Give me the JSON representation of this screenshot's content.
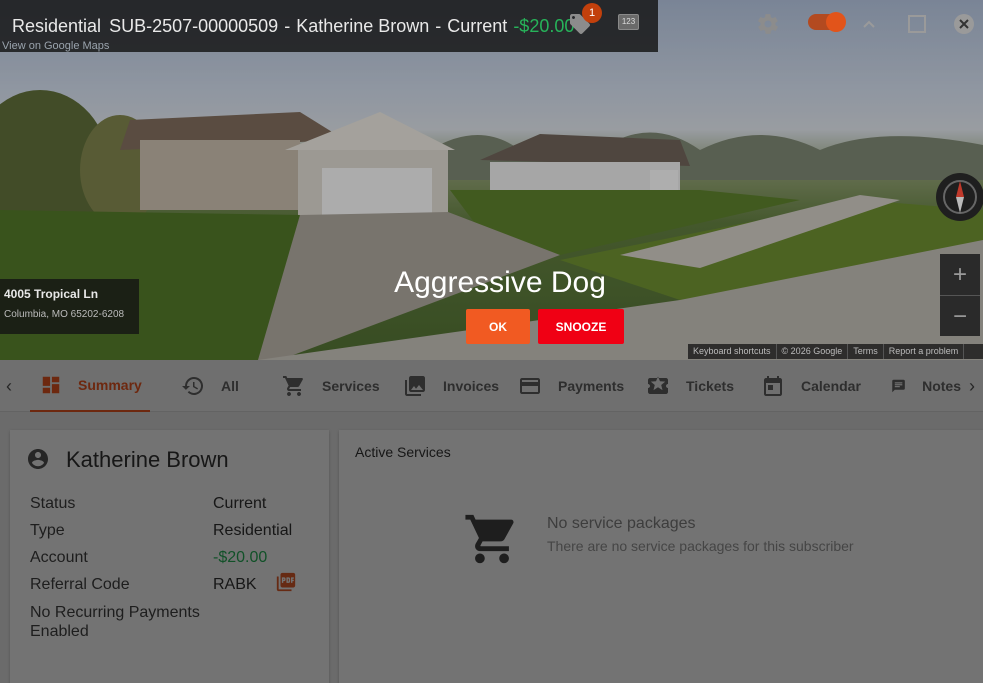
{
  "header": {
    "type": "Residential",
    "subscriber_id": "SUB-2507-00000509",
    "separator": "-",
    "name": "Katherine Brown",
    "status": "Current",
    "balance": "-$20.00",
    "tag_count": "1",
    "numeric_icon_label": "123",
    "maps_link": "View on Google Maps"
  },
  "address": {
    "line1": "4005 Tropical Ln",
    "line2": "Columbia, MO 65202-6208"
  },
  "map_attribution": [
    "Keyboard shortcuts",
    "© 2026 Google",
    "Terms",
    "Report a problem"
  ],
  "zoom": {
    "in": "+",
    "out": "−"
  },
  "alert": {
    "title": "Aggressive Dog",
    "ok_label": "OK",
    "snooze_label": "SNOOZE"
  },
  "tabs": [
    {
      "label": "Summary",
      "icon": "dashboard-icon",
      "active": true
    },
    {
      "label": "All",
      "icon": "history-icon"
    },
    {
      "label": "Services",
      "icon": "cart-icon"
    },
    {
      "label": "Invoices",
      "icon": "image-icon"
    },
    {
      "label": "Payments",
      "icon": "credit-card-icon"
    },
    {
      "label": "Tickets",
      "icon": "ticket-icon"
    },
    {
      "label": "Calendar",
      "icon": "calendar-icon"
    },
    {
      "label": "Notes",
      "icon": "note-icon"
    }
  ],
  "nav": {
    "prev": "‹",
    "next": "›"
  },
  "summary": {
    "name": "Katherine Brown",
    "fields": [
      {
        "label": "Status",
        "value": "Current"
      },
      {
        "label": "Type",
        "value": "Residential"
      },
      {
        "label": "Account",
        "value": "-$20.00"
      },
      {
        "label": "Referral Code",
        "value": "RABK"
      }
    ],
    "recurring_note": "No Recurring Payments Enabled"
  },
  "services": {
    "title": "Active Services",
    "empty_title": "No service packages",
    "empty_sub": "There are no service packages for this subscriber"
  },
  "colors": {
    "accent": "#f15a22",
    "snooze": "#f00014",
    "positive": "#27b35a"
  }
}
